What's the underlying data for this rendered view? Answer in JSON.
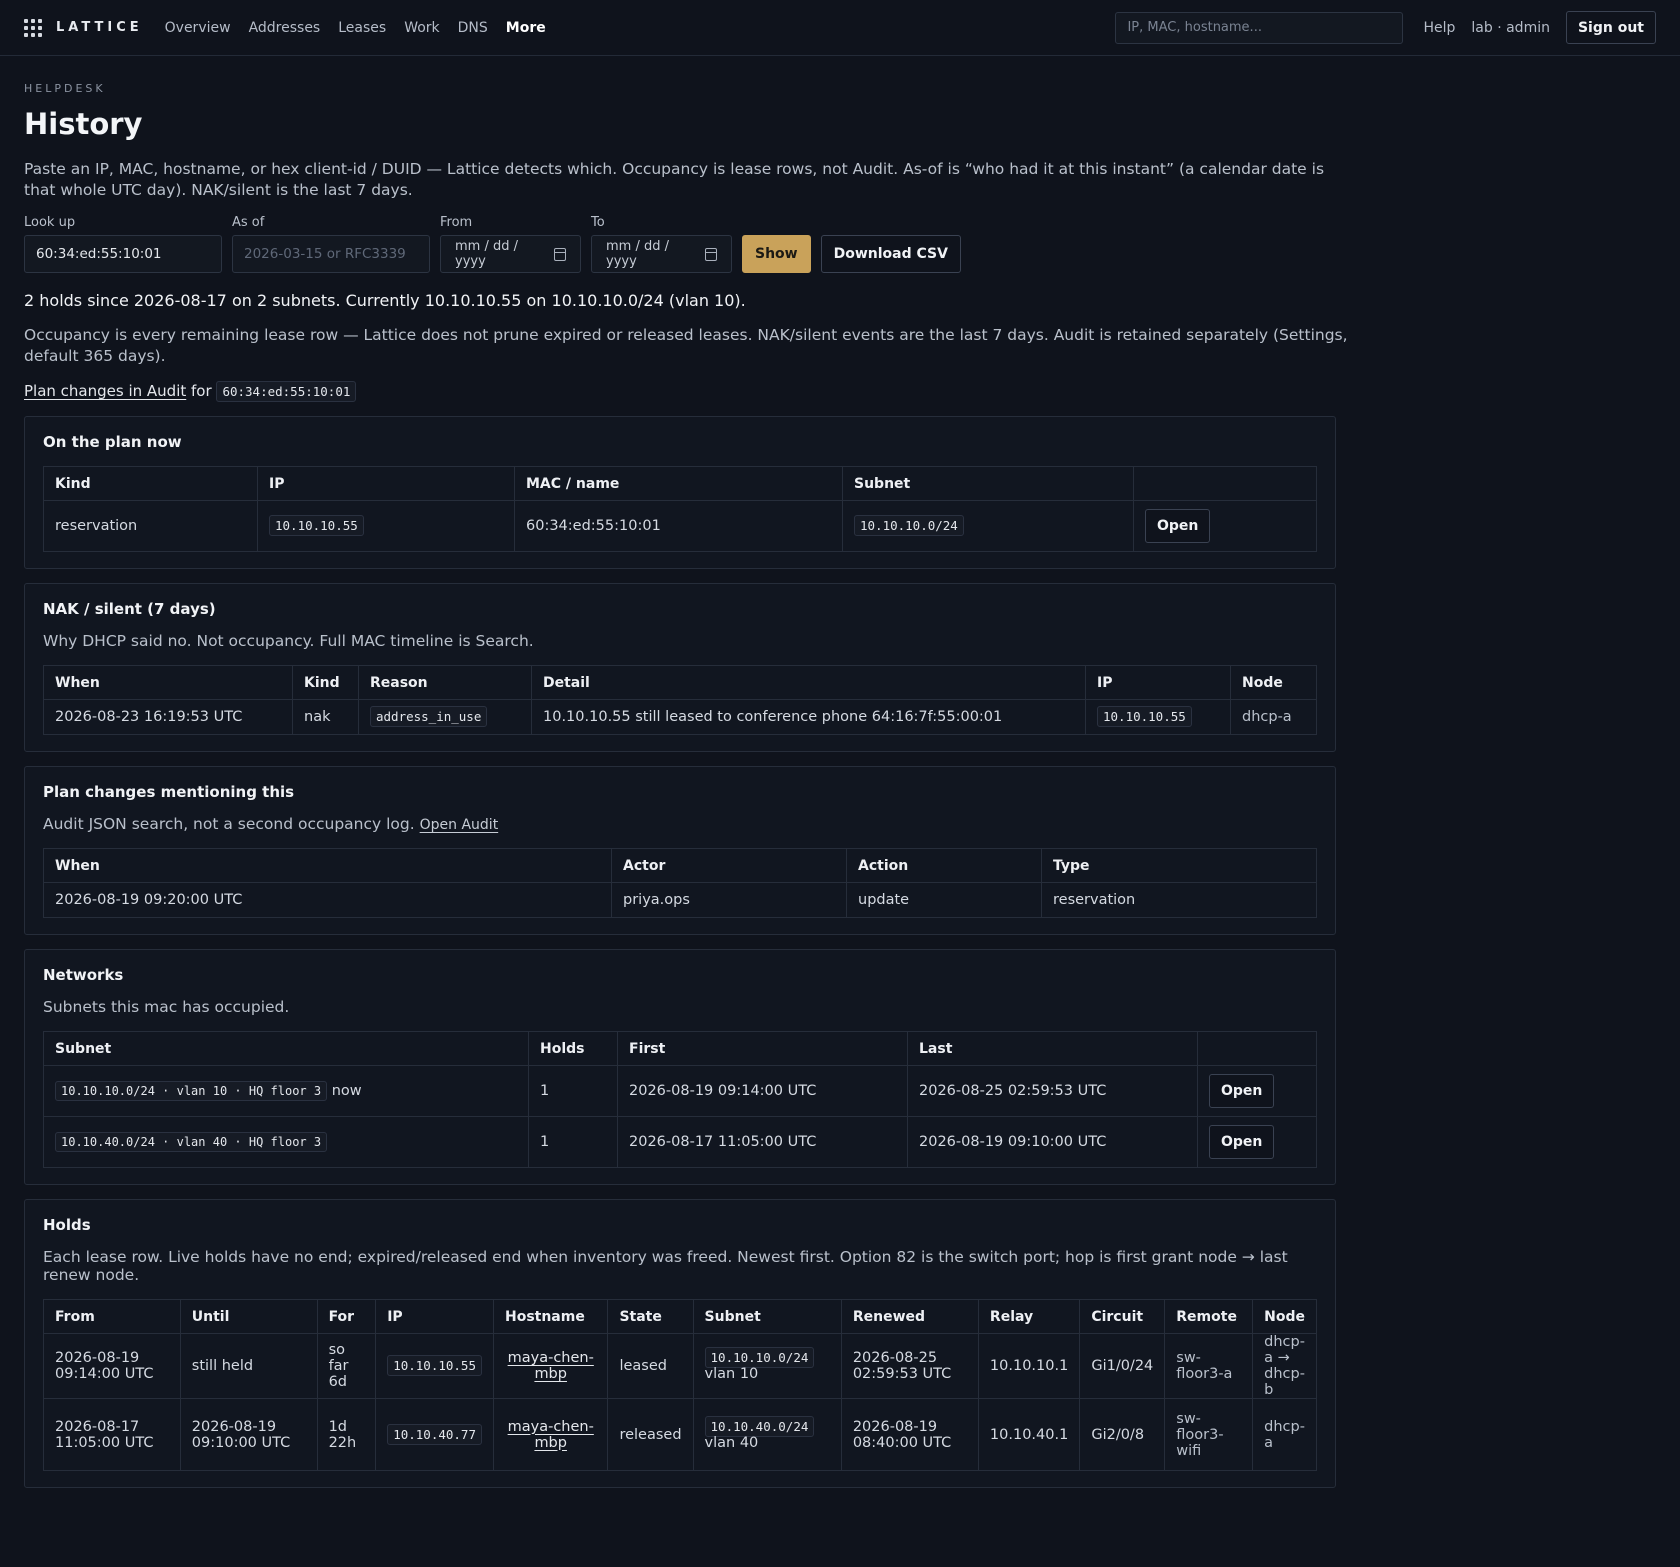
{
  "app": {
    "name": "LATTICE"
  },
  "nav": {
    "items": [
      "Overview",
      "Addresses",
      "Leases",
      "Work",
      "DNS",
      "More"
    ]
  },
  "topbar": {
    "search_placeholder": "IP, MAC, hostname...",
    "help_label": "Help",
    "user_label": "lab · admin",
    "signout_label": "Sign out"
  },
  "page": {
    "eyebrow": "HELPDESK",
    "title": "History",
    "intro": "Paste an IP, MAC, hostname, or hex client-id / DUID — Lattice detects which. Occupancy is lease rows, not Audit. As-of is “who had it at this instant” (a calendar date is that whole UTC day). NAK/silent is the last 7 days."
  },
  "form": {
    "lookup_label": "Look up",
    "lookup_value": "60:34:ed:55:10:01",
    "asof_label": "As of",
    "asof_placeholder": "2026-03-15 or RFC3339",
    "from_label": "From",
    "to_label": "To",
    "date_placeholder": "mm / dd / yyyy",
    "show_label": "Show",
    "csv_label": "Download CSV"
  },
  "summary": "2 holds since 2026-08-17 on 2 subnets. Currently 10.10.10.55 on 10.10.10.0/24 (vlan 10).",
  "retention": "Occupancy is every remaining lease row — Lattice does not prune expired or released leases. NAK/silent events are the last 7 days. Audit is retained separately (Settings, default 365 days).",
  "audit_line": {
    "link": "Plan changes in Audit",
    "for": "for",
    "code": "60:34:ed:55:10:01"
  },
  "plan_now": {
    "title": "On the plan now",
    "headers": [
      "Kind",
      "IP",
      "MAC / name",
      "Subnet",
      ""
    ],
    "rows": [
      {
        "kind": "reservation",
        "ip": "10.10.10.55",
        "mac": "60:34:ed:55:10:01",
        "subnet": "10.10.10.0/24",
        "action": "Open"
      }
    ]
  },
  "nak": {
    "title": "NAK / silent (7 days)",
    "desc": "Why DHCP said no. Not occupancy. Full MAC timeline is Search.",
    "headers": [
      "When",
      "Kind",
      "Reason",
      "Detail",
      "IP",
      "Node"
    ],
    "rows": [
      {
        "when": "2026-08-23 16:19:53 UTC",
        "kind": "nak",
        "reason": "address_in_use",
        "detail": "10.10.10.55 still leased to conference phone 64:16:7f:55:00:01",
        "ip": "10.10.10.55",
        "node": "dhcp-a"
      }
    ]
  },
  "plan_changes": {
    "title": "Plan changes mentioning this",
    "desc": "Audit JSON search, not a second occupancy log.",
    "desc_link": "Open Audit",
    "headers": [
      "When",
      "Actor",
      "Action",
      "Type"
    ],
    "rows": [
      {
        "when": "2026-08-19 09:20:00 UTC",
        "actor": "priya.ops",
        "action": "update",
        "type": "reservation"
      }
    ]
  },
  "networks": {
    "title": "Networks",
    "desc": "Subnets this mac has occupied.",
    "headers": [
      "Subnet",
      "Holds",
      "First",
      "Last",
      ""
    ],
    "rows": [
      {
        "subnet": "10.10.10.0/24 · vlan 10 · HQ floor 3",
        "now": "now",
        "holds": "1",
        "first": "2026-08-19 09:14:00 UTC",
        "last": "2026-08-25 02:59:53 UTC",
        "action": "Open"
      },
      {
        "subnet": "10.10.40.0/24 · vlan 40 · HQ floor 3",
        "now": "",
        "holds": "1",
        "first": "2026-08-17 11:05:00 UTC",
        "last": "2026-08-19 09:10:00 UTC",
        "action": "Open"
      }
    ]
  },
  "holds": {
    "title": "Holds",
    "desc": "Each lease row. Live holds have no end; expired/released end when inventory was freed. Newest first. Option 82 is the switch port; hop is first grant node → last renew node.",
    "headers": [
      "From",
      "Until",
      "For",
      "IP",
      "Hostname",
      "State",
      "Subnet",
      "Renewed",
      "Relay",
      "Circuit",
      "Remote",
      "Node"
    ],
    "rows": [
      {
        "from": "2026-08-19 09:14:00 UTC",
        "until": "still held",
        "for": "so far 6d",
        "ip": "10.10.10.55",
        "hostname": "maya-chen-mbp",
        "state": "leased",
        "subnet": "10.10.10.0/24",
        "vlan": "vlan 10",
        "renewed": "2026-08-25 02:59:53 UTC",
        "relay": "10.10.10.1",
        "circuit": "Gi1/0/24",
        "remote": "sw-floor3-a",
        "node": "dhcp-a → dhcp-b"
      },
      {
        "from": "2026-08-17 11:05:00 UTC",
        "until": "2026-08-19 09:10:00 UTC",
        "for": "1d 22h",
        "ip": "10.10.40.77",
        "hostname": "maya-chen-mbp",
        "state": "released",
        "subnet": "10.10.40.0/24",
        "vlan": "vlan 40",
        "renewed": "2026-08-19 08:40:00 UTC",
        "relay": "10.10.40.1",
        "circuit": "Gi2/0/8",
        "remote": "sw-floor3-wifi",
        "node": "dhcp-a"
      }
    ]
  }
}
